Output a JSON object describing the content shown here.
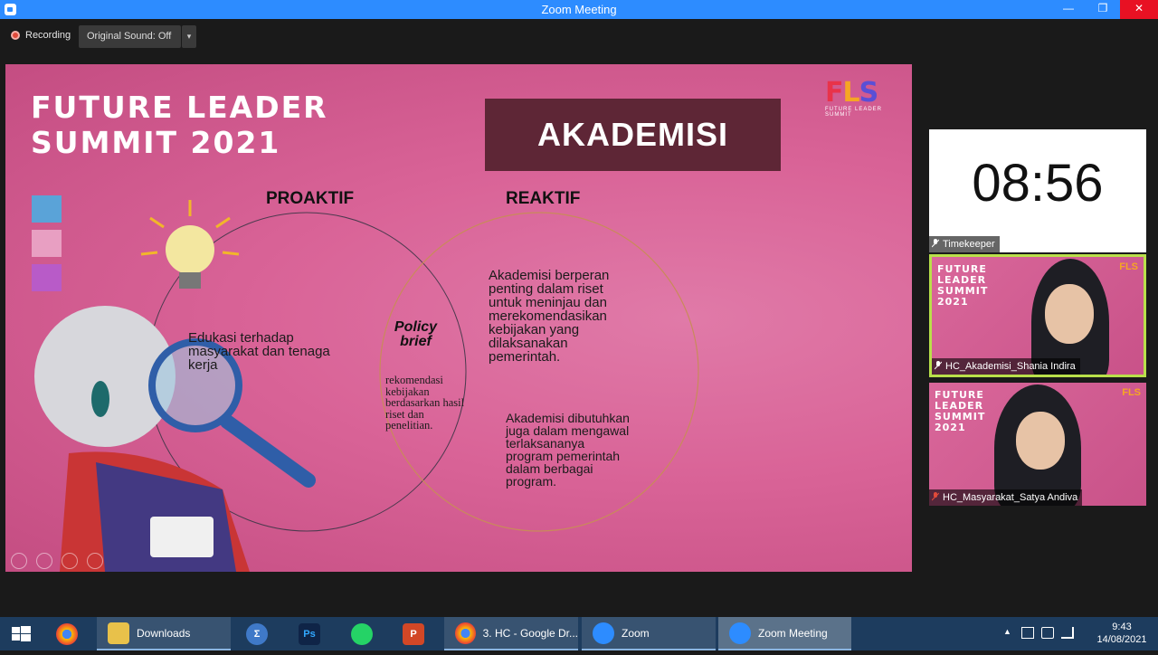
{
  "window": {
    "title": "Zoom Meeting",
    "minimize": "—",
    "restore": "❐",
    "close": "✕"
  },
  "toolbar": {
    "recording_label": "Recording",
    "original_sound_label": "Original Sound: Off",
    "dropdown_caret": "▾"
  },
  "slide": {
    "title_line1": "FUTURE LEADER",
    "title_line2": "SUMMIT 2021",
    "banner": "AKADEMISI",
    "logo_letters": [
      "F",
      "L",
      "S"
    ],
    "logo_caption": "FUTURE LEADER SUMMIT",
    "proaktif": "PROAKTIF",
    "reaktif": "REAKTIF",
    "left_text": "Edukasi terhadap masyarakat dan tenaga kerja",
    "policy_line1": "Policy",
    "policy_line2": "brief",
    "policy_detail": "rekomendasi kebijakan berdasarkan hasil riset dan penelitian.",
    "right_text_1": "Akademisi berperan penting dalam riset untuk meninjau dan merekomendasikan kebijakan yang dilaksanakan pemerintah.",
    "right_text_2": "Akademisi dibutuhkan juga dalam mengawal terlaksananya program pemerintah dalam berbagai program.",
    "swatch_colors": [
      "#5aa3d8",
      "#e89fc2",
      "#b85bc8"
    ]
  },
  "participants": {
    "timer_value": "08:56",
    "timer_name": "Timekeeper",
    "tile1_name": "HC_Akademisi_Shania Indira",
    "tile2_name": "HC_Masyarakat_Satya Andiva",
    "tile_title": "FUTURE LEADER SUMMIT 2021",
    "tile_logo": "FLS"
  },
  "taskbar": {
    "items": [
      {
        "name": "chrome",
        "label": ""
      },
      {
        "name": "downloads",
        "label": "Downloads"
      },
      {
        "name": "sigma",
        "label": ""
      },
      {
        "name": "photoshop",
        "label": "Ps"
      },
      {
        "name": "whatsapp",
        "label": ""
      },
      {
        "name": "powerpoint",
        "label": "P"
      },
      {
        "name": "chrome-drive",
        "label": "3. HC - Google Dr..."
      },
      {
        "name": "zoom",
        "label": "Zoom"
      },
      {
        "name": "zoom-meeting",
        "label": "Zoom Meeting"
      }
    ],
    "time": "9:43",
    "date": "14/08/2021",
    "tray_caret": "▲"
  },
  "colors": {
    "zoom_blue": "#2d8cff",
    "active_speaker": "#b9e04a",
    "slide_pink": "#d96397",
    "banner_maroon": "#5e2636"
  }
}
